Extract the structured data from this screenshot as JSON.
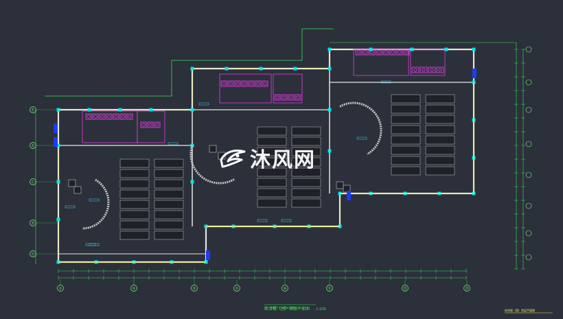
{
  "drawing": {
    "watermark_text": "沐风网",
    "title": "综合楼（团）首层平面图",
    "title_scale": "1:100",
    "subtitle": "注：本图尺寸以毫米为单位",
    "corner_note": "综合楼（团）首层平面图"
  },
  "axes": {
    "bottom": [
      "①",
      "③",
      "⑤",
      "⑦",
      "⑨",
      "⑪",
      "⑬",
      "⑮"
    ],
    "left": [
      "Ⓔ",
      "Ⓓ",
      "Ⓒ",
      "Ⓑ",
      "Ⓐ"
    ]
  },
  "colors": {
    "background": "#2b303a",
    "wall": "#e6e6e6",
    "wall_fill": "#f1ef6a",
    "dimension": "#3be05a",
    "fixtures": "#e83ce8",
    "columns": "#00e6e6",
    "text_small": "#4cd6ff",
    "axis_bubble": "#7dff7d",
    "watermark": "#ffffff",
    "furniture": "#c8c8c8"
  },
  "icons": {
    "watermark_logo": "mufeng-logo-icon"
  }
}
